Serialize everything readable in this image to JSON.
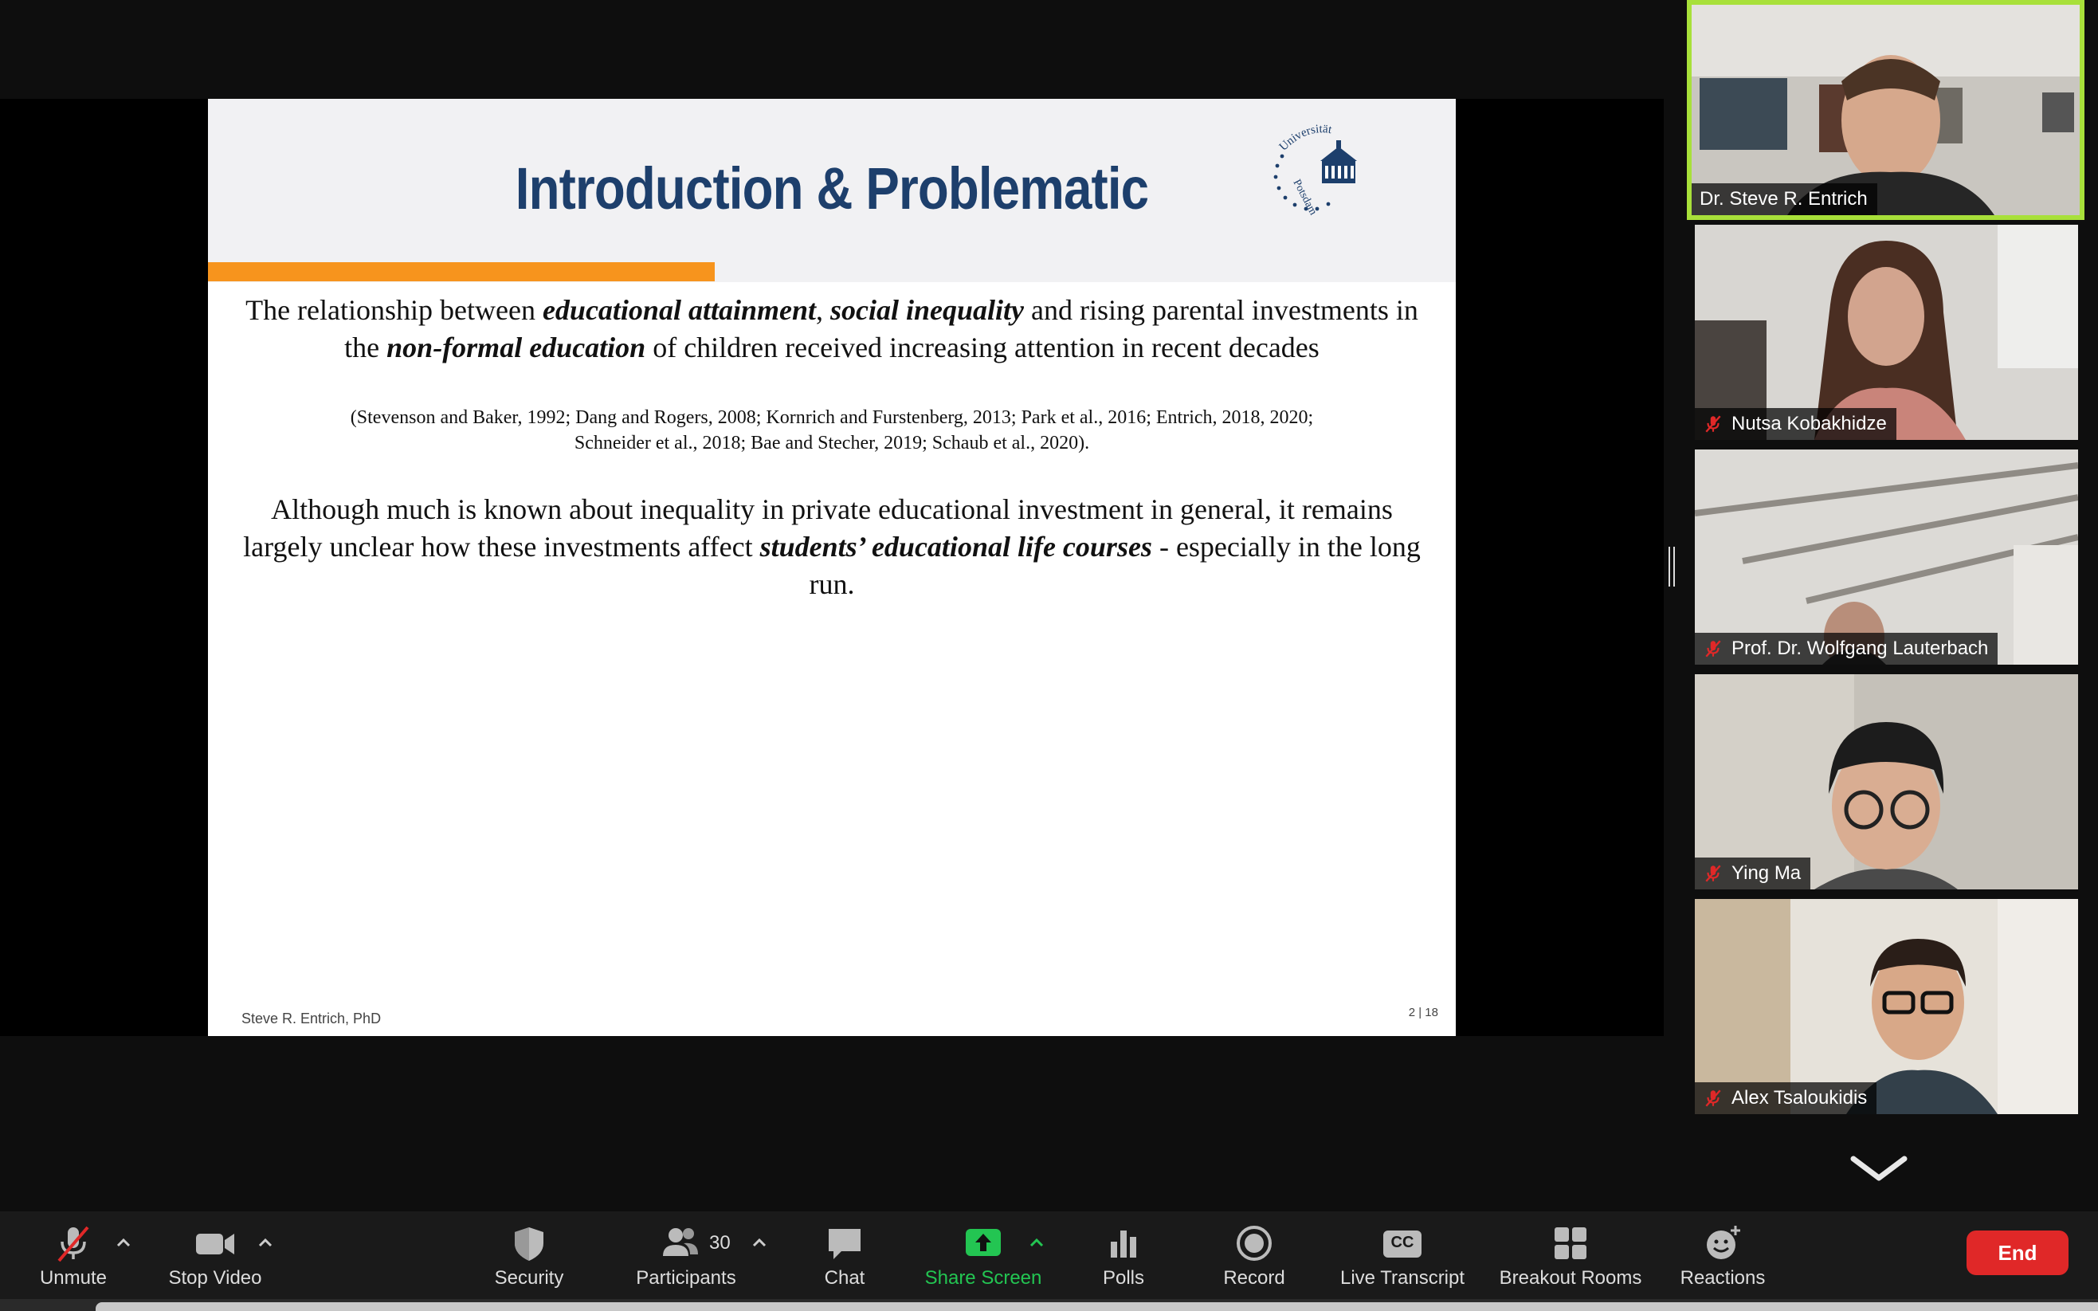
{
  "slide": {
    "title": "Introduction & Problematic",
    "logo_text": "Universität Potsdam",
    "para1": {
      "t1": "The relationship between ",
      "b1": "educational attainment",
      "t2": ", ",
      "b2": "social inequality",
      "t3": " and rising parental investments in the ",
      "b3": "non-formal education",
      "t4": " of children received increasing attention in recent decades"
    },
    "citation_line1": "(Stevenson and Baker, 1992; Dang and Rogers, 2008; Kornrich and Furstenberg, 2013; Park et al., 2016; Entrich, 2018, 2020;",
    "citation_line2": "Schneider et al., 2018; Bae and Stecher, 2019; Schaub et al., 2020).",
    "para2": {
      "t1": "Although much is known about inequality in private educational investment in general, it remains largely unclear how these investments affect ",
      "b1": "students’ educational life courses",
      "t2": " - especially in the long run."
    },
    "footer_author": "Steve R. Entrich, PhD",
    "footer_page": "2 | 18"
  },
  "participants_gallery": [
    {
      "name": "Dr. Steve R. Entrich",
      "muted": false,
      "active_speaker": true
    },
    {
      "name": "Nutsa Kobakhidze",
      "muted": true
    },
    {
      "name": "Prof. Dr. Wolfgang Lauterbach",
      "muted": true
    },
    {
      "name": "Ying Ma",
      "muted": true
    },
    {
      "name": "Alex Tsaloukidis",
      "muted": true
    }
  ],
  "toolbar": {
    "unmute": "Unmute",
    "stop_video": "Stop Video",
    "security": "Security",
    "participants": "Participants",
    "participants_count": "30",
    "chat": "Chat",
    "share_screen": "Share Screen",
    "polls": "Polls",
    "record": "Record",
    "live_transcript": "Live Transcript",
    "cc": "CC",
    "breakout_rooms": "Breakout Rooms",
    "reactions": "Reactions",
    "end": "End"
  },
  "colors": {
    "active_speaker_border": "#a8e03a",
    "share_green": "#23c552",
    "end_red": "#e02828",
    "slide_title_blue": "#1d3f6c",
    "slide_orange": "#f7941d"
  }
}
